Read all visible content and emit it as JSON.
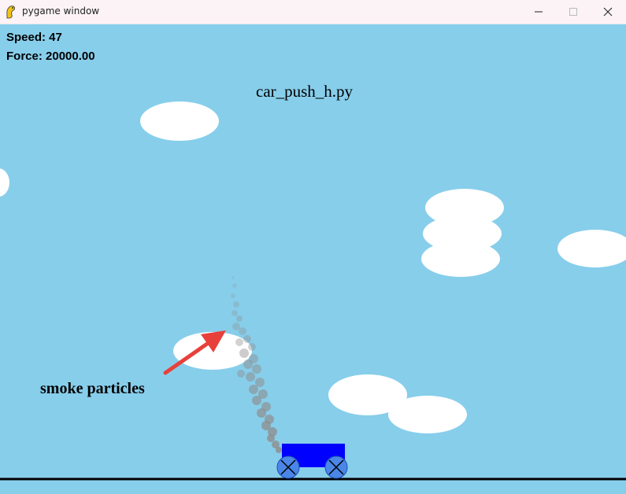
{
  "window": {
    "title": "pygame window",
    "icon": "pygame-snake-icon",
    "controls": [
      "minimize-icon",
      "maximize-icon",
      "close-icon"
    ]
  },
  "hud": {
    "speed_text": "Speed: 47",
    "force_text": "Force: 20000.00"
  },
  "scene": {
    "script_name": "car_push_h.py",
    "annotation_label": "smoke particles",
    "colors": {
      "sky": "#87CEEB",
      "cloud": "#FFFFFF",
      "car_body": "#0000FF",
      "wheel": "#4A86E8",
      "ground_line": "#000000",
      "smoke": "#8E8E8E",
      "arrow": "#E8403A"
    }
  }
}
